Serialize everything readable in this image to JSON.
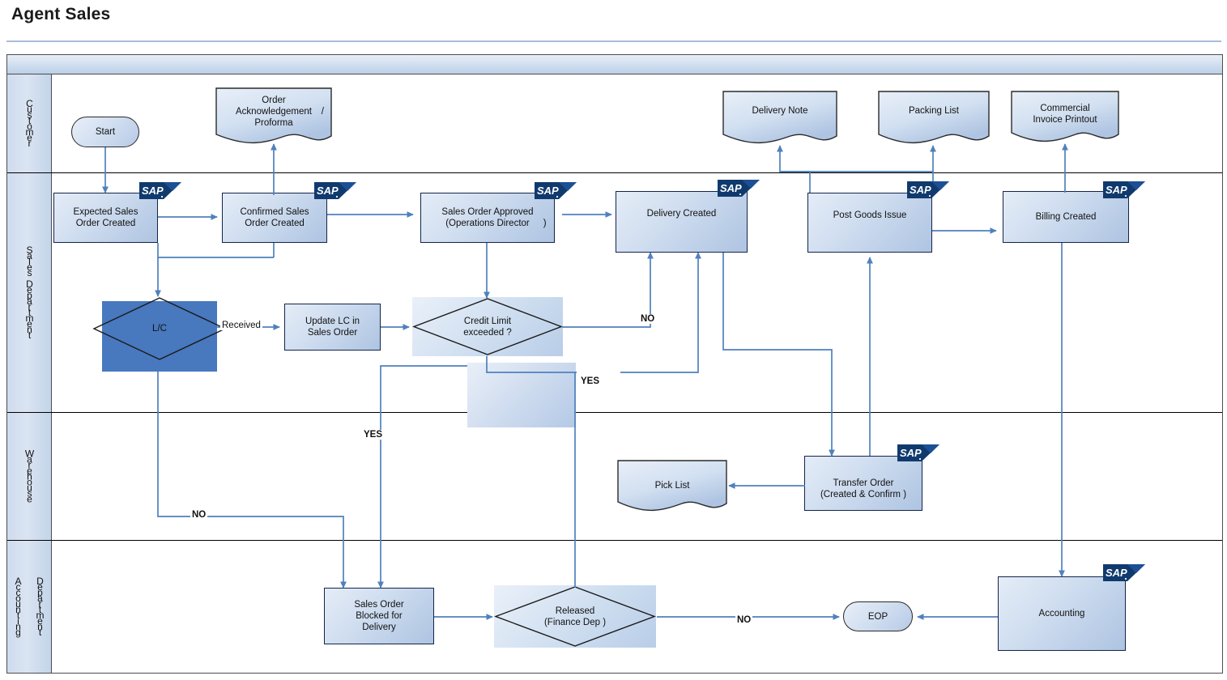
{
  "page": {
    "title": "Agent Sales",
    "accent_line_color": "#a9bcd9"
  },
  "colors": {
    "node_border": "#14244a",
    "node_fill_light": "#e4ecf7",
    "node_fill_dark": "#aec4e2",
    "connector": "#4f81bd",
    "lane_fill": "#cfdcef",
    "selection": "#4878be",
    "sap_blue": "#103a6e"
  },
  "pool": {
    "header_label": "",
    "lanes": [
      {
        "name": "customer",
        "label": "Customer",
        "letters": [
          "C",
          "u",
          "s",
          "t",
          "o",
          "m",
          "e",
          "r"
        ]
      },
      {
        "name": "sales-department",
        "label": "Sales Department",
        "letters": [
          "S",
          "a",
          "l",
          "e",
          "s",
          " ",
          "D",
          "e",
          "p",
          "a",
          "r",
          "t",
          "m",
          "e",
          "n",
          "t"
        ]
      },
      {
        "name": "warehouse",
        "label": "Warehouse",
        "letters": [
          "W",
          "a",
          "r",
          "e",
          "h",
          "o",
          "u",
          "s",
          "e"
        ]
      },
      {
        "name": "accounting-department",
        "label": "Accounting Department",
        "col_a": [
          "A",
          "c",
          "c",
          "o",
          "u",
          "n",
          "t",
          "i",
          "n",
          "g"
        ],
        "col_b": [
          "D",
          "e",
          "p",
          "a",
          "r",
          "t",
          "m",
          "e",
          "n",
          "t"
        ]
      }
    ]
  },
  "nodes": [
    {
      "id": "start",
      "type": "terminator",
      "label": "Start",
      "lane": "customer",
      "sap": false
    },
    {
      "id": "order-ack",
      "type": "document",
      "label": "Order Acknowledgement   /  Proforma",
      "lane": "customer",
      "sap": false
    },
    {
      "id": "delivery-note",
      "type": "document",
      "label": "Delivery Note",
      "lane": "customer",
      "sap": false
    },
    {
      "id": "packing-list",
      "type": "document",
      "label": "Packing List",
      "lane": "customer",
      "sap": false
    },
    {
      "id": "commercial-invoice",
      "type": "document",
      "label": "Commercial Invoice Printout",
      "lane": "customer",
      "sap": false
    },
    {
      "id": "expected-so",
      "type": "process",
      "label": "Expected Sales Order Created",
      "lane": "sales-department",
      "sap": true
    },
    {
      "id": "confirmed-so",
      "type": "process",
      "label": "Confirmed Sales Order Created",
      "lane": "sales-department",
      "sap": true
    },
    {
      "id": "so-approved",
      "type": "process",
      "label": "Sales Order Approved (Operations Director    )",
      "lane": "sales-department",
      "sap": true
    },
    {
      "id": "delivery-created",
      "type": "process",
      "label": "Delivery Created",
      "lane": "sales-department",
      "sap": true
    },
    {
      "id": "post-goods-issue",
      "type": "process",
      "label": "Post Goods Issue",
      "lane": "sales-department",
      "sap": true
    },
    {
      "id": "billing-created",
      "type": "process",
      "label": "Billing Created",
      "lane": "sales-department",
      "sap": true
    },
    {
      "id": "lc",
      "type": "decision",
      "label": "L/C",
      "lane": "sales-department",
      "sap": false,
      "selected": true
    },
    {
      "id": "update-lc",
      "type": "process",
      "label": "Update LC in Sales Order",
      "lane": "sales-department",
      "sap": false
    },
    {
      "id": "credit-limit",
      "type": "decision",
      "label": "Credit Limit exceeded   ?",
      "lane": "sales-department",
      "sap": false
    },
    {
      "id": "pick-list",
      "type": "document",
      "label": "Pick List",
      "lane": "warehouse",
      "sap": false
    },
    {
      "id": "transfer-order",
      "type": "process",
      "label": "Transfer Order (Created   & Confirm  )",
      "lane": "warehouse",
      "sap": true
    },
    {
      "id": "so-blocked",
      "type": "process",
      "label": "Sales Order Blocked for Delivery",
      "lane": "accounting-department",
      "sap": false
    },
    {
      "id": "released",
      "type": "decision",
      "label": "Released (Finance Dep   )",
      "lane": "accounting-department",
      "sap": false
    },
    {
      "id": "eop",
      "type": "terminator",
      "label": "EOP",
      "lane": "accounting-department",
      "sap": false
    },
    {
      "id": "accounting",
      "type": "process",
      "label": "Accounting",
      "lane": "accounting-department",
      "sap": true
    }
  ],
  "node_labels": {
    "start": "Start",
    "order_ack_l1": "Order",
    "order_ack_l2": "Acknowledgement",
    "order_ack_slash": "/",
    "order_ack_l3": "Proforma",
    "delivery_note": "Delivery Note",
    "packing_list": "Packing List",
    "commercial_invoice_l1": "Commercial",
    "commercial_invoice_l2": "Invoice Printout",
    "expected_so_l1": "Expected Sales",
    "expected_so_l2": "Order Created",
    "confirmed_so_l1": "Confirmed Sales",
    "confirmed_so_l2": "Order Created",
    "so_approved_l1": "Sales Order Approved",
    "so_approved_l2": "(Operations Director",
    "so_approved_l2b": ")",
    "delivery_created": "Delivery Created",
    "post_goods_issue": "Post Goods Issue",
    "billing_created": "Billing Created",
    "lc": "L/C",
    "update_lc_l1": "Update LC in",
    "update_lc_l2": "Sales Order",
    "credit_limit_l1": "Credit Limit",
    "credit_limit_l2": "exceeded  ?",
    "pick_list": "Pick List",
    "transfer_order_l1": "Transfer Order",
    "transfer_order_l2": "(Created   & Confirm  )",
    "so_blocked_l1": "Sales Order",
    "so_blocked_l2": "Blocked for",
    "so_blocked_l3": "Delivery",
    "released_l1": "Released",
    "released_l2": "(Finance Dep   )",
    "eop": "EOP",
    "accounting": "Accounting",
    "sap_badge": "SAP"
  },
  "flow_labels": [
    {
      "id": "lc-received",
      "text": "Received",
      "at": "right-of-lc"
    },
    {
      "id": "credit-no",
      "text": "NO",
      "at": "right-of-credit-limit"
    },
    {
      "id": "credit-yes",
      "text": "YES",
      "at": "below-right-of-credit-limit"
    },
    {
      "id": "approved-yes",
      "text": "YES",
      "at": "left-branch-down"
    },
    {
      "id": "lc-no",
      "text": "NO",
      "at": "lc-down-left"
    },
    {
      "id": "released-no",
      "text": "NO",
      "at": "right-of-released"
    }
  ]
}
